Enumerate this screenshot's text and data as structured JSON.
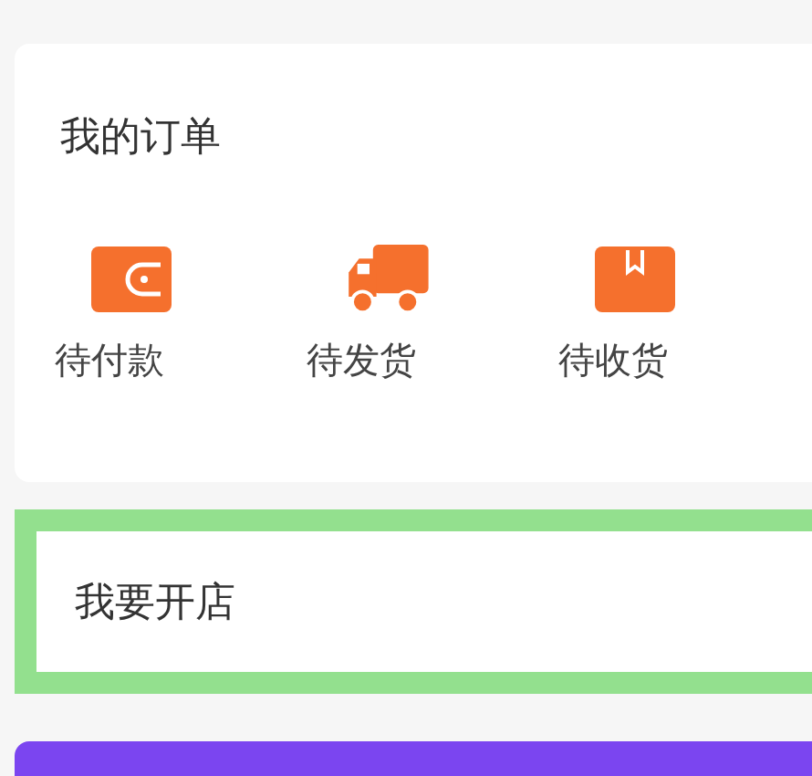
{
  "orders": {
    "title": "我的订单",
    "items": [
      {
        "kind": "wallet",
        "label": "待付款"
      },
      {
        "kind": "truck",
        "label": "待发货"
      },
      {
        "kind": "box",
        "label": "待收货"
      }
    ]
  },
  "open_shop": {
    "label": "我要开店"
  }
}
